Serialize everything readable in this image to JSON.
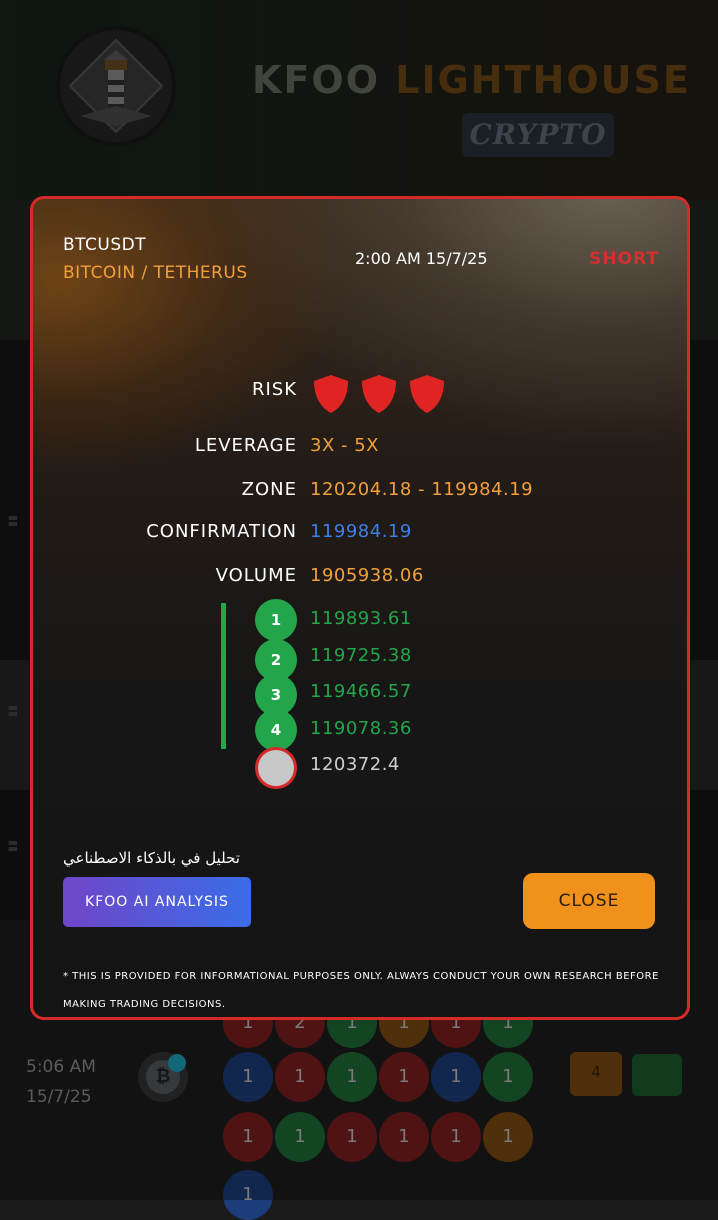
{
  "header": {
    "brand_part1": "KFOO",
    "brand_part2": "LIGHTHOUSE",
    "category_badge": "CRYPTO",
    "logo_icon": "lighthouse-icon"
  },
  "background_list": {
    "time": "5:06 AM",
    "date": "15/7/25",
    "coin_icon": "bitcoin-icon",
    "doc_badge": "4",
    "grid_rows": [
      [
        {
          "v": "1",
          "c": "r"
        },
        {
          "v": "2",
          "c": "r"
        },
        {
          "v": "1",
          "c": "g"
        },
        {
          "v": "1",
          "c": "o"
        },
        {
          "v": "1",
          "c": "r"
        },
        {
          "v": "1",
          "c": "g"
        }
      ],
      [
        {
          "v": "1",
          "c": "b"
        },
        {
          "v": "1",
          "c": "r"
        },
        {
          "v": "1",
          "c": "g"
        },
        {
          "v": "1",
          "c": "r"
        },
        {
          "v": "1",
          "c": "b"
        },
        {
          "v": "1",
          "c": "g"
        }
      ],
      [
        {
          "v": "1",
          "c": "r"
        },
        {
          "v": "1",
          "c": "g"
        },
        {
          "v": "1",
          "c": "r"
        },
        {
          "v": "1",
          "c": "r"
        },
        {
          "v": "1",
          "c": "r"
        },
        {
          "v": "1",
          "c": "o"
        }
      ],
      [
        {
          "v": "1",
          "c": "b"
        }
      ]
    ]
  },
  "signal": {
    "symbol": "BTCUSDT",
    "pair_name": "BITCOIN / TETHERUS",
    "timestamp": "2:00 AM 15/7/25",
    "direction": "SHORT",
    "risk_label": "RISK",
    "risk_level": 3,
    "risk_icon": "shield-icon",
    "leverage_label": "LEVERAGE",
    "leverage_value": "3X - 5X",
    "zone_label": "ZONE",
    "zone_value": "120204.18 - 119984.19",
    "confirmation_label": "CONFIRMATION",
    "confirmation_value": "119984.19",
    "volume_label": "VOLUME",
    "volume_value": "1905938.06",
    "targets": [
      {
        "n": "1",
        "value": "119893.61"
      },
      {
        "n": "2",
        "value": "119725.38"
      },
      {
        "n": "3",
        "value": "119466.57"
      },
      {
        "n": "4",
        "value": "119078.36"
      }
    ],
    "stop_loss": "120372.4",
    "ai_caption": "تحليل في بالذكاء الاصطناعي",
    "ai_button": "KFOO AI ANALYSIS",
    "close_button": "CLOSE",
    "disclaimer": "* THIS IS PROVIDED FOR INFORMATIONAL PURPOSES ONLY. ALWAYS CONDUCT YOUR OWN RESEARCH BEFORE MAKING TRADING DECISIONS."
  },
  "colors": {
    "accent_orange": "#f2a03b",
    "short_red": "#d53030",
    "target_green": "#23a64a",
    "confirmation_blue": "#3f7fe8"
  }
}
